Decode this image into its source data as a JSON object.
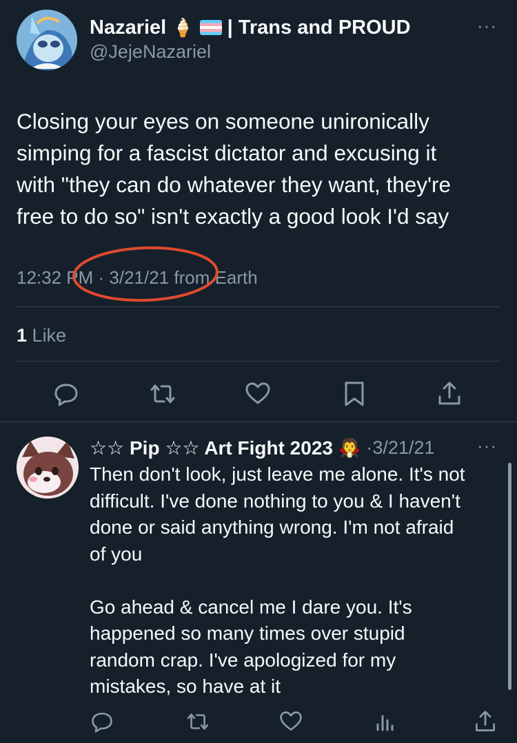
{
  "tweet": {
    "display_name": "Nazariel",
    "name_emoji": "🍦",
    "name_suffix": "| Trans and PROUD",
    "handle": "@JejeNazariel",
    "more": "···",
    "lines": [
      "Closing your eyes on someone unironically",
      "simping for a fascist dictator and excusing it",
      "with \"they can do whatever they want, they're",
      "free to do so\" isn't exactly a good look I'd say"
    ],
    "meta": "12:32 PM · 3/21/21 from Earth",
    "like_count": "1",
    "like_label": "Like"
  },
  "reply": {
    "display_name": "☆☆ Pip ☆☆ Art Fight 2023",
    "name_emoji": "🧛",
    "date": "·3/21/21",
    "more": "···",
    "lines": [
      "Then don't look, just leave me alone. It's not",
      "difficult. I've done nothing to you & I haven't",
      "done or said anything wrong. I'm not afraid",
      "of you",
      "",
      "Go ahead & cancel me I dare you. It's",
      "happened so many times over stupid",
      "random crap. I've apologized for my",
      "mistakes, so have at it"
    ]
  },
  "annotation": {
    "circle_color": "#e0492f"
  },
  "colors": {
    "background": "#15202b",
    "text": "#f7f9f9",
    "muted": "#8b98a5",
    "divider": "#38444d"
  },
  "icons": [
    "reply-icon",
    "retweet-icon",
    "like-icon",
    "bookmark-icon",
    "share-icon",
    "views-icon"
  ]
}
